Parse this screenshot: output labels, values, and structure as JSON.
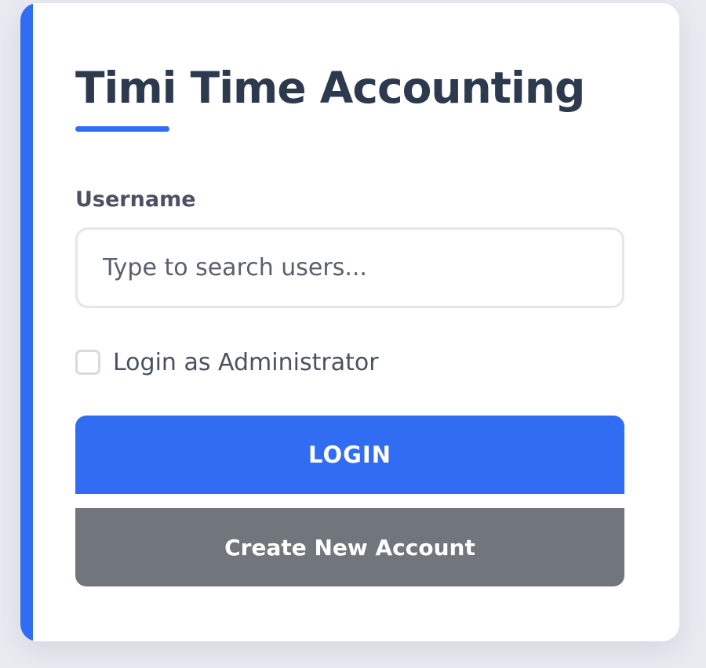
{
  "app": {
    "title": "Timi Time Accounting"
  },
  "form": {
    "username_label": "Username",
    "username_value": "",
    "username_placeholder": "Type to search users...",
    "admin_checkbox_label": "Login as Administrator",
    "admin_checked": false,
    "login_button_label": "LOGIN",
    "create_account_button_label": "Create New Account"
  },
  "colors": {
    "accent": "#316df2",
    "title": "#2d3a4e",
    "secondary_button": "#71767d",
    "background": "#e9ebf1"
  }
}
